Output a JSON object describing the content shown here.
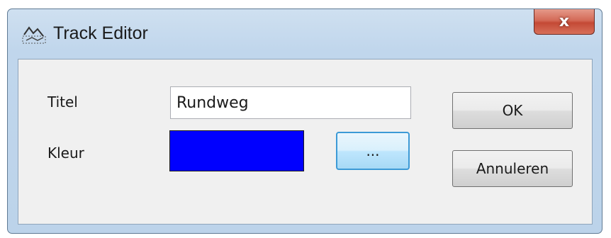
{
  "window": {
    "title": "Track Editor",
    "title_icon": "track-map-icon",
    "close_symbol": "x"
  },
  "form": {
    "title_label": "Titel",
    "title_value": "Rundweg",
    "color_label": "Kleur",
    "color_value": "#0000ff",
    "color_picker_label": "..."
  },
  "buttons": {
    "ok_label": "OK",
    "cancel_label": "Annuleren"
  }
}
